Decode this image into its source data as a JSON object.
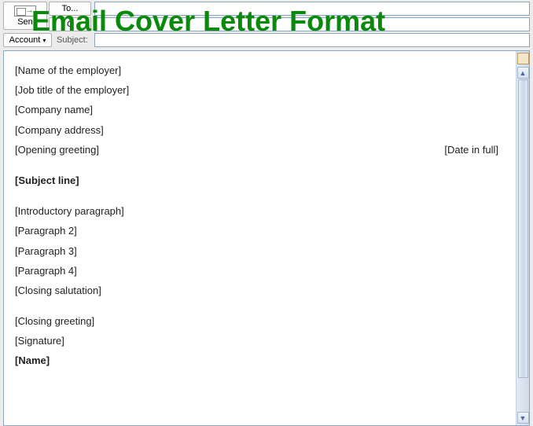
{
  "toolbar": {
    "send_label": "Sen",
    "to_label": "To...",
    "cc_partial": "C",
    "account_label": "Account",
    "subject_label": "Subject:"
  },
  "overlay": {
    "title": "Email Cover Letter Format"
  },
  "body": {
    "line_employer_name": "[Name of the employer]",
    "line_job_title": "[Job title of the employer]",
    "line_company_name": "[Company name]",
    "line_company_address": "[Company address]",
    "line_opening_greeting": "[Opening greeting]",
    "line_date": "[Date in full]",
    "line_subject": "[Subject line]",
    "line_intro": "[Introductory paragraph]",
    "line_p2": "[Paragraph 2]",
    "line_p3": "[Paragraph 3]",
    "line_p4": "[Paragraph 4]",
    "line_closing_salutation": "[Closing salutation]",
    "line_closing_greeting": "[Closing greeting]",
    "line_signature": "[Signature]",
    "line_name": "[Name]"
  },
  "icons": {
    "scroll_up": "▲",
    "scroll_down": "▼",
    "dropdown": "▾"
  }
}
